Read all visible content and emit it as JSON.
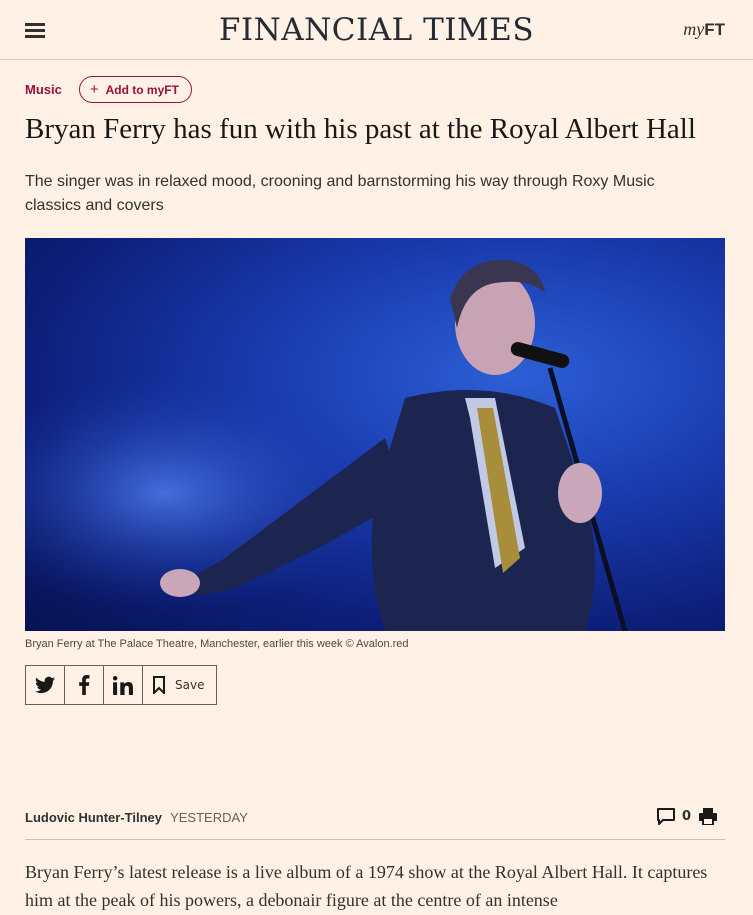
{
  "header": {
    "masthead": "FINANCIAL TIMES",
    "myft_my": "my",
    "myft_ft": "FT"
  },
  "topic": {
    "label": "Music",
    "add_myft_label": "Add to myFT"
  },
  "article": {
    "title": "Bryan Ferry has fun with his past at the Royal Albert Hall",
    "standfirst": "The singer was in relaxed mood, crooning and barnstorming his way through Roxy Music classics and covers",
    "image_caption": "Bryan Ferry at The Palace Theatre, Manchester, earlier this week © Avalon.red",
    "author": "Ludovic Hunter-Tilney",
    "timestamp": "YESTERDAY",
    "comment_count": "0",
    "body": "Bryan Ferry’s latest release is a live album of a 1974 show at the Royal Albert Hall. It captures him at the peak of his powers, a debonair figure at the centre of an intense"
  },
  "share": {
    "save_label": "Save",
    "icons": [
      "twitter-icon",
      "facebook-icon",
      "linkedin-icon",
      "bookmark-icon"
    ]
  },
  "colors": {
    "background": "#fff1e5",
    "accent": "#990f3d",
    "text": "#33302e"
  }
}
